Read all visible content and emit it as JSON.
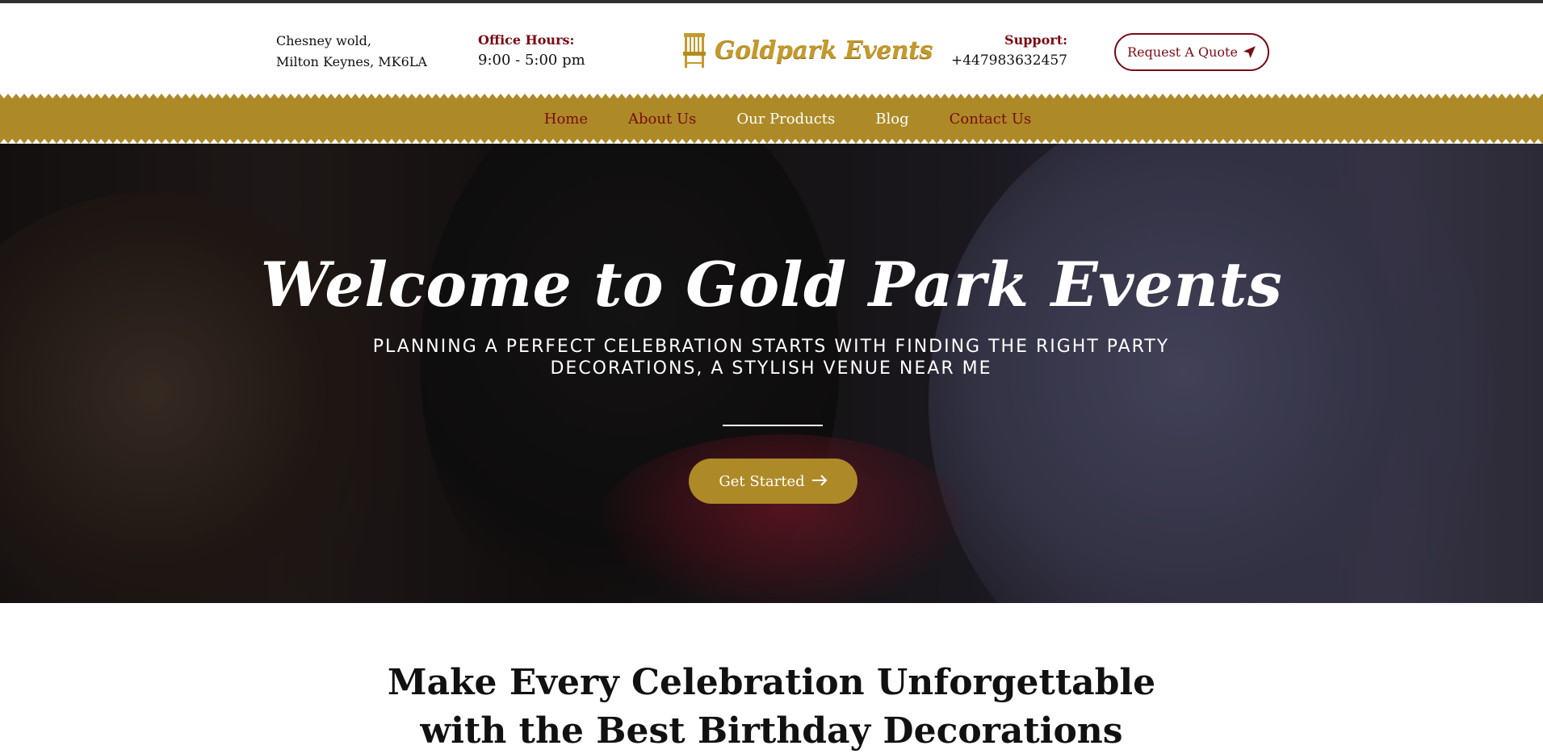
{
  "header": {
    "address_line1": "Chesney wold,",
    "address_line2": "Milton Keynes, MK6LA",
    "office_hours_label": "Office Hours:",
    "office_hours_value": "9:00 - 5:00 pm",
    "logo_text": "Goldpark Events",
    "support_label": "Support:",
    "support_phone": "+447983632457",
    "quote_button": "Request A Quote"
  },
  "nav": {
    "items": [
      {
        "label": "Home"
      },
      {
        "label": "About Us"
      },
      {
        "label": "Our Products"
      },
      {
        "label": "Blog"
      },
      {
        "label": "Contact Us"
      }
    ]
  },
  "hero": {
    "title": "Welcome to Gold Park Events",
    "subtitle": "PLANNING A PERFECT CELEBRATION STARTS WITH FINDING THE RIGHT PARTY DECORATIONS, A STYLISH VENUE NEAR ME",
    "cta": "Get Started"
  },
  "section": {
    "title_line1": "Make Every Celebration Unforgettable",
    "title_line2": "with the Best Birthday Decorations"
  },
  "colors": {
    "gold": "#ad8a27",
    "maroon": "#7a0a14",
    "top_border": "#2f2f2f"
  },
  "icons": {
    "quote": "paper-plane-icon",
    "cta": "arrow-right-icon",
    "logo": "chair-icon"
  }
}
